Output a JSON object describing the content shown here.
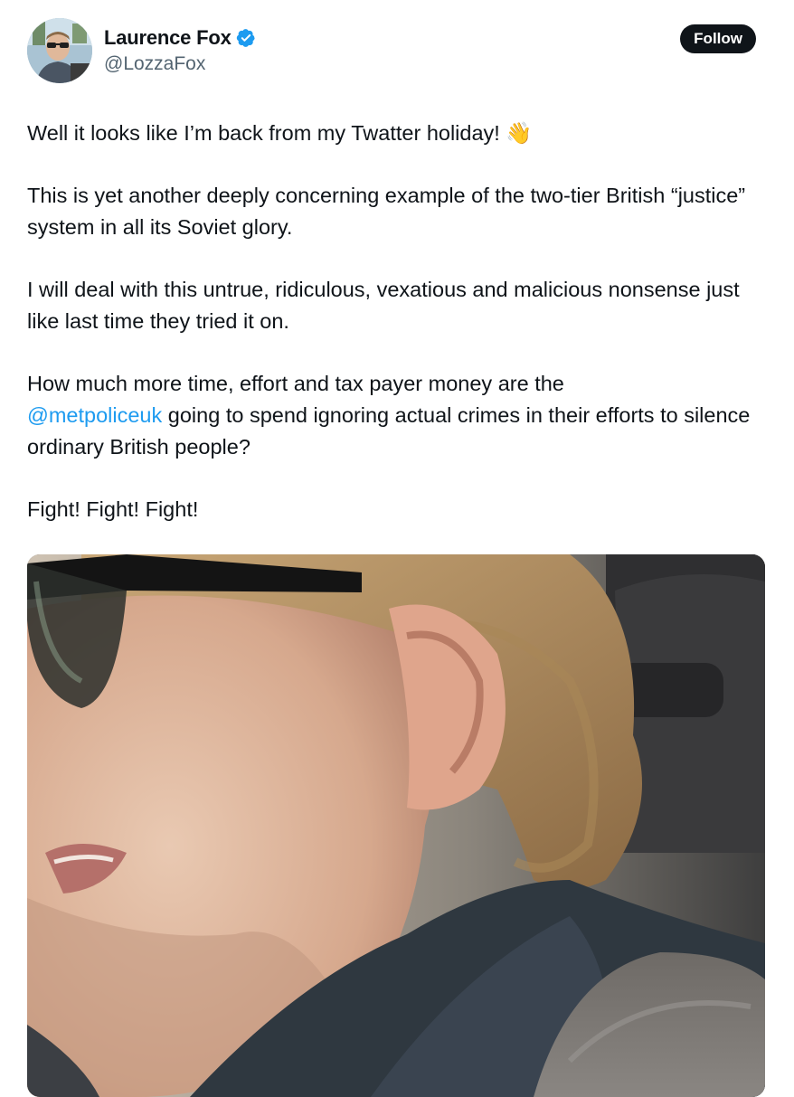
{
  "author": {
    "display_name": "Laurence Fox",
    "handle": "@LozzaFox",
    "verified": true,
    "verified_badge_color": "#1d9bf0",
    "avatar_icon": "profile-photo"
  },
  "follow_button": {
    "label": "Follow"
  },
  "tweet": {
    "paragraphs": [
      {
        "text": "Well it looks like I’m back from my Twatter holiday!",
        "emoji": "👋"
      },
      {
        "text": "This is yet another deeply concerning example of the two-tier British “justice” system in all its Soviet glory."
      },
      {
        "text": "I will deal with this untrue, ridiculous, vexatious and malicious nonsense just like last time they tried it on."
      },
      {
        "text_before": "How much more time, effort and tax payer money are the",
        "mention": "@metpoliceuk",
        "text_after": " going to spend ignoring actual crimes in their efforts to silence ordinary British people?"
      },
      {
        "text": "Fight! Fight! Fight!"
      }
    ],
    "mention_color": "#1d9bf0"
  },
  "media": {
    "type": "video-still",
    "icon": "video-frame"
  }
}
